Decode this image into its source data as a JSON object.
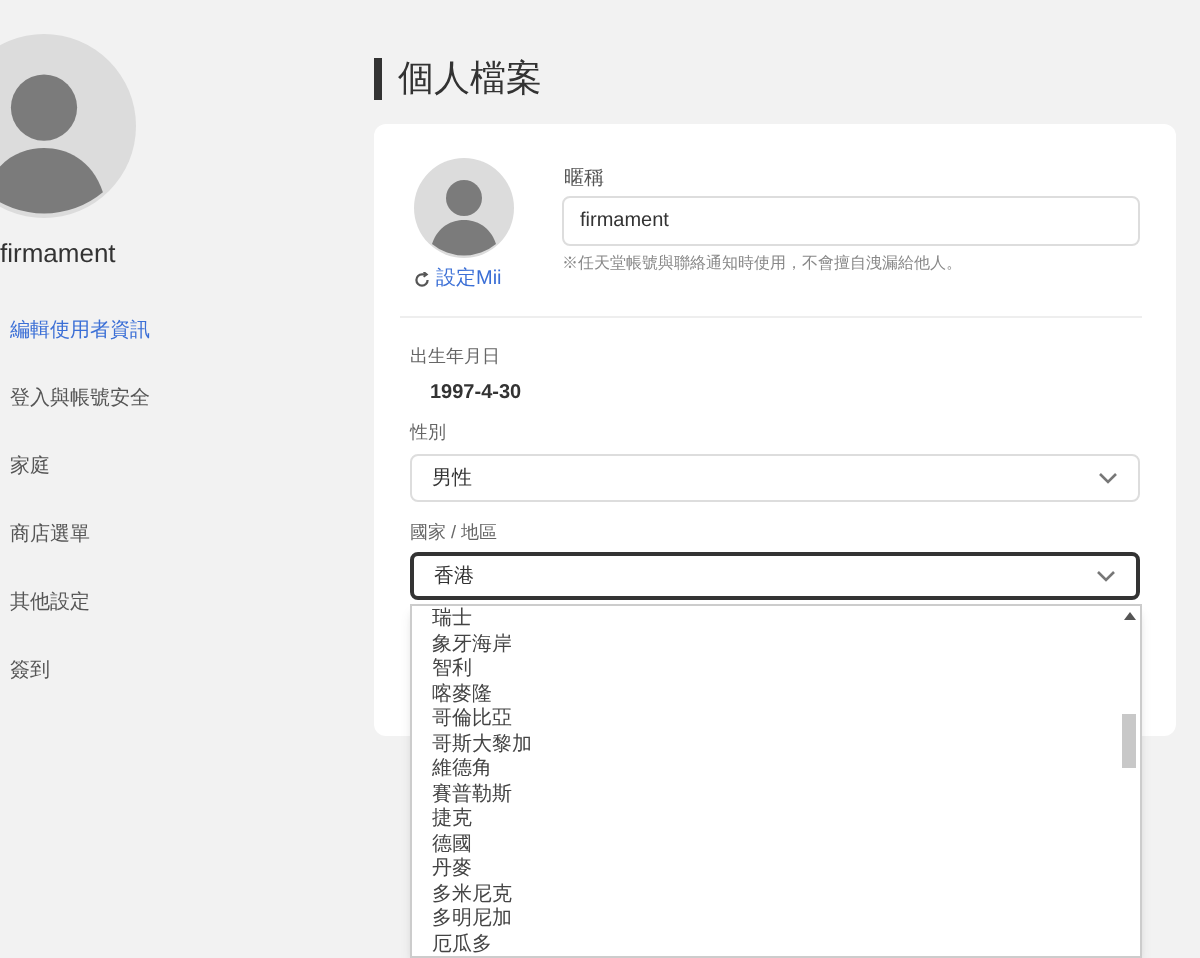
{
  "profile": {
    "name": "firmament"
  },
  "sidebar": {
    "items": [
      {
        "label": "編輯使用者資訊",
        "selected": true
      },
      {
        "label": "登入與帳號安全",
        "selected": false
      },
      {
        "label": "家庭",
        "selected": false
      },
      {
        "label": "商店選單",
        "selected": false
      },
      {
        "label": "其他設定",
        "selected": false
      },
      {
        "label": "簽到",
        "selected": false
      }
    ]
  },
  "page": {
    "title": "個人檔案"
  },
  "card": {
    "mii_link": "設定Mii",
    "nickname": {
      "label": "暱稱",
      "value": "firmament",
      "hint": "※任天堂帳號與聯絡通知時使用，不會擅自洩漏給他人。"
    },
    "birthday": {
      "label": "出生年月日",
      "value": "1997-4-30"
    },
    "gender": {
      "label": "性別",
      "value": "男性"
    },
    "country": {
      "label": "國家 / 地區",
      "value": "香港",
      "expanded": true,
      "options": [
        "瑞士",
        "象牙海岸",
        "智利",
        "喀麥隆",
        "哥倫比亞",
        "哥斯大黎加",
        "維德角",
        "賽普勒斯",
        "捷克",
        "德國",
        "丹麥",
        "多米尼克",
        "多明尼加",
        "厄瓜多"
      ]
    }
  }
}
